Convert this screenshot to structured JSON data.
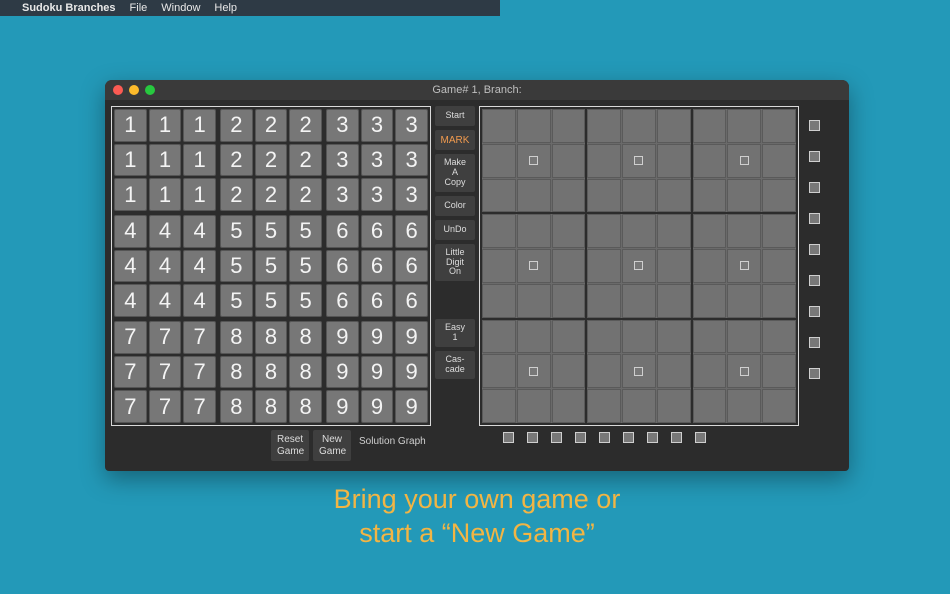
{
  "menubar": {
    "apple": "",
    "appname": "Sudoku Branches",
    "items": [
      "File",
      "Window",
      "Help"
    ]
  },
  "window": {
    "title": "Game# 1, Branch:"
  },
  "board": {
    "box_digits": [
      "1",
      "2",
      "3",
      "4",
      "5",
      "6",
      "7",
      "8",
      "9"
    ]
  },
  "midbuttons": [
    "Start",
    "MARK",
    "Make\nA\nCopy",
    "Color",
    "UnDo",
    "Little\nDigit\nOn",
    "",
    "Easy\n1",
    "Cas-\ncade"
  ],
  "below": {
    "reset": "Reset\nGame",
    "new": "New\nGame",
    "solution": "Solution Graph"
  },
  "solve": {
    "center_checks": [
      [
        1,
        1
      ],
      [
        1,
        4
      ],
      [
        1,
        7
      ],
      [
        4,
        1
      ],
      [
        4,
        4
      ],
      [
        4,
        7
      ],
      [
        7,
        1
      ],
      [
        7,
        4
      ],
      [
        7,
        7
      ]
    ]
  },
  "caption_l1": "Bring your own game  or",
  "caption_l2": "start a “New Game”"
}
